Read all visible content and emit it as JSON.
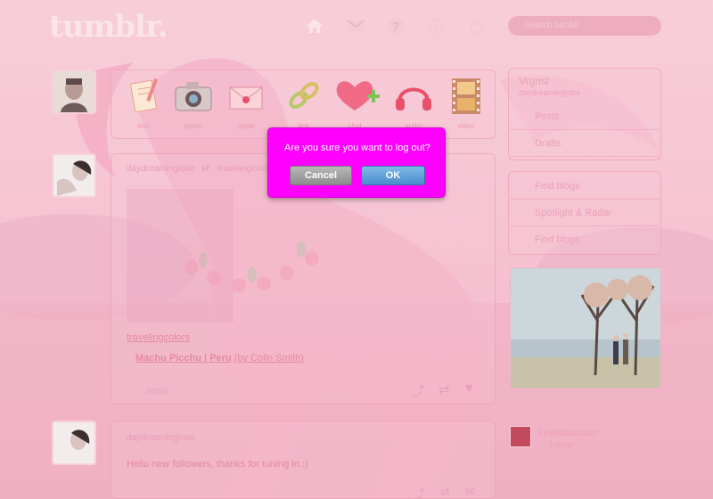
{
  "header": {
    "logo": "tumblr.",
    "search_placeholder": "Search tumblr",
    "nav_icons": [
      "home-icon",
      "mail-icon",
      "help-icon",
      "gear-icon",
      "power-icon"
    ]
  },
  "post_types": [
    {
      "icon": "text-notepad-icon",
      "label": "text"
    },
    {
      "icon": "camera-icon",
      "label": "photo"
    },
    {
      "icon": "quote-envelope-icon",
      "label": "quote"
    },
    {
      "icon": "link-chain-icon",
      "label": "link"
    },
    {
      "icon": "heart-plus-icon",
      "label": "chat"
    },
    {
      "icon": "headphones-icon",
      "label": "audio"
    },
    {
      "icon": "film-strip-icon",
      "label": "video"
    }
  ],
  "dashboard": {
    "post1": {
      "author": "daydreaminglobe",
      "reblog_source": "travelingcolors",
      "source_link": "travelingcolors",
      "caption_title": "Machu Picchu | Peru",
      "caption_credit": "(by Colin Smith)",
      "notes": "notes"
    },
    "post2": {
      "author": "daydreaminglobe",
      "text": "Hello new followers, thanks for tuning in :)"
    }
  },
  "sidebar": {
    "blog_name": "Vrgnsl",
    "blog_sub": "daydreaminglobe",
    "items_a": [
      "Posts",
      "Drafts"
    ],
    "items_b": [
      "Find blogs",
      "Spotlight & Radar",
      "Find blogs"
    ],
    "radar_user": "kylehibbutson",
    "radar_action": "Follow"
  },
  "modal": {
    "message": "Are you sure you want to log out?",
    "cancel_label": "Cancel",
    "ok_label": "OK"
  },
  "colors": {
    "modal_bg": "#ff00ff",
    "ok_button": "#5b9bd5",
    "cancel_button": "#9e9e9e",
    "overlay": "#f6becd"
  }
}
